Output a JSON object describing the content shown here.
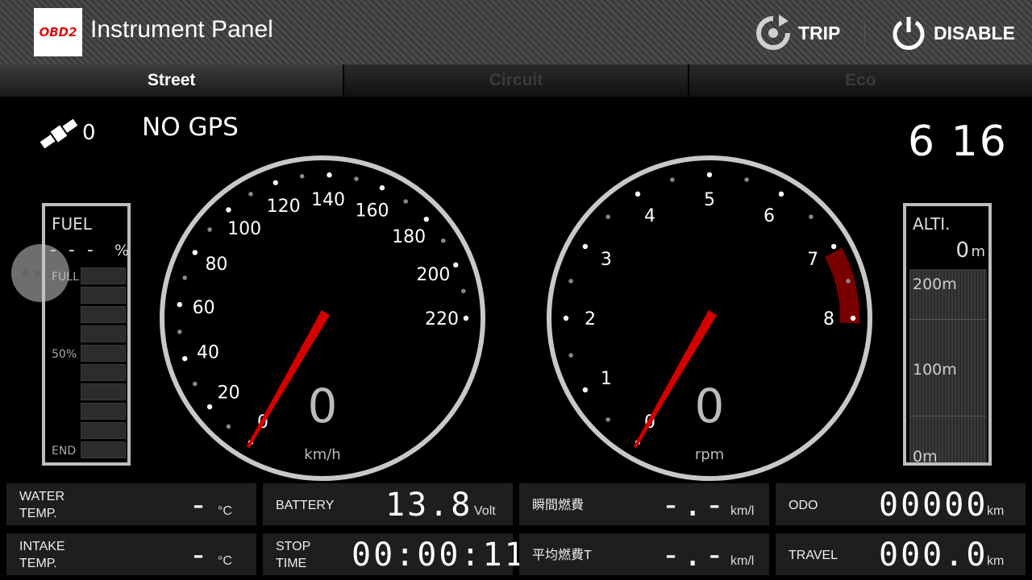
{
  "header": {
    "logo_text": "OBD2",
    "title": "Instrument Panel",
    "trip_label": "TRIP",
    "disable_label": "DISABLE"
  },
  "tabs": [
    {
      "label": "Street",
      "active": true
    },
    {
      "label": "Circuit",
      "active": false
    },
    {
      "label": "Eco",
      "active": false
    }
  ],
  "gps": {
    "satellites": "0",
    "status": "NO GPS"
  },
  "clock": "6 16",
  "fuel": {
    "label": "FUEL",
    "value": "- - -",
    "unit": "%",
    "full_label": "FULL",
    "half_label": "50%",
    "end_label": "END",
    "level_fraction": 0
  },
  "altitude": {
    "label": "ALTI.",
    "value": "0",
    "unit": "m",
    "marks": [
      "200m",
      "100m",
      "0m"
    ]
  },
  "speedometer": {
    "value": "0",
    "unit": "km/h",
    "tick_labels": [
      "0",
      "20",
      "40",
      "60",
      "80",
      "100",
      "120",
      "140",
      "160",
      "180",
      "200",
      "220"
    ],
    "max": 220,
    "needle_value": 0
  },
  "tachometer": {
    "value": "0",
    "unit": "rpm",
    "tick_labels": [
      "0",
      "1",
      "2",
      "3",
      "4",
      "5",
      "6",
      "7",
      "8"
    ],
    "max": 8,
    "redline_start": 7,
    "needle_value": 0
  },
  "panels": {
    "water_temp": {
      "label_line1": "WATER",
      "label_line2": "TEMP.",
      "value": "-",
      "unit": "°C"
    },
    "intake_temp": {
      "label_line1": "INTAKE",
      "label_line2": "TEMP.",
      "value": "-",
      "unit": "°C"
    },
    "battery": {
      "label": "BATTERY",
      "value": "13.8",
      "unit": "Volt"
    },
    "stop_time": {
      "label_line1": "STOP",
      "label_line2": "TIME",
      "value": "00:00:11"
    },
    "instant_fuel": {
      "label": "瞬間燃費",
      "value": "-.-",
      "unit": "km/l"
    },
    "avg_fuel": {
      "label": "平均燃費T",
      "value": "-.-",
      "unit": "km/l"
    },
    "odo": {
      "label": "ODO",
      "value": "00000",
      "unit": "km"
    },
    "travel": {
      "label": "TRAVEL",
      "value": "000.0",
      "unit": "km"
    }
  },
  "colors": {
    "needle": "#d40000",
    "redline": "#7a0000",
    "bezel": "#c8c8c8"
  },
  "icons": {
    "trip": "refresh-icon",
    "disable": "power-icon",
    "gps": "satellite-icon"
  }
}
